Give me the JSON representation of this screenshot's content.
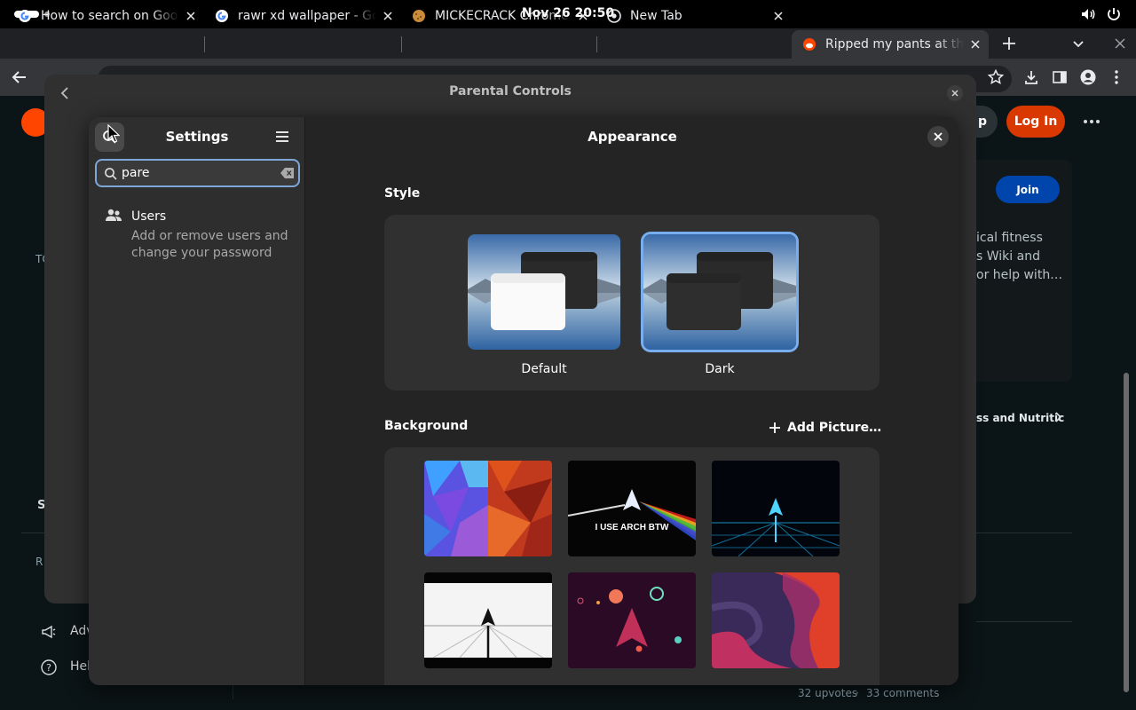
{
  "topbar": {
    "clock": "Nov 26  20:50"
  },
  "tabs": [
    {
      "title": "How to search on Goo"
    },
    {
      "title": "rawr xd wallpaper - Go"
    },
    {
      "title": "MICKECRACK Chrome"
    },
    {
      "title": "New Tab"
    },
    {
      "title": "Ripped my pants at the"
    }
  ],
  "reddit": {
    "signup_label": "p",
    "login_label": "Log In",
    "join_label": "Join",
    "about_lines": [
      "ical fitness",
      "s Wiki and",
      "or help with…"
    ],
    "community_link": "ss and Nutritic",
    "left_items": {
      "topics_initial": "TO",
      "s_initial": "S",
      "r_initial": "R",
      "advertise": "Adv",
      "help": "Hel"
    },
    "stats": {
      "upvotes": "32 upvotes",
      "separator": "·",
      "comments": "33 comments"
    }
  },
  "parental_controls": {
    "title": "Parental Controls"
  },
  "settings": {
    "sidebar_title": "Settings",
    "search_value": "pare",
    "results": [
      {
        "title": "Users",
        "subtitle": "Add or remove users and change your password"
      }
    ],
    "page_title": "Appearance",
    "style_section": "Style",
    "style_options": [
      {
        "label": "Default",
        "selected": false
      },
      {
        "label": "Dark",
        "selected": true
      }
    ],
    "background_section": "Background",
    "add_picture_label": "Add Picture…",
    "wallpaper_text": "I USE ARCH BTW",
    "wallpapers": [
      "blue-red-polygon-wallpaper",
      "arch-prism-wallpaper",
      "arch-neon-grid-wallpaper",
      "arch-white-bridge-wallpaper",
      "arch-planets-wallpaper",
      "red-purple-waves-wallpaper"
    ]
  },
  "colors": {
    "accent": "#78aeed",
    "reddit_orange": "#d93900",
    "reddit_blue": "#0045ac"
  }
}
